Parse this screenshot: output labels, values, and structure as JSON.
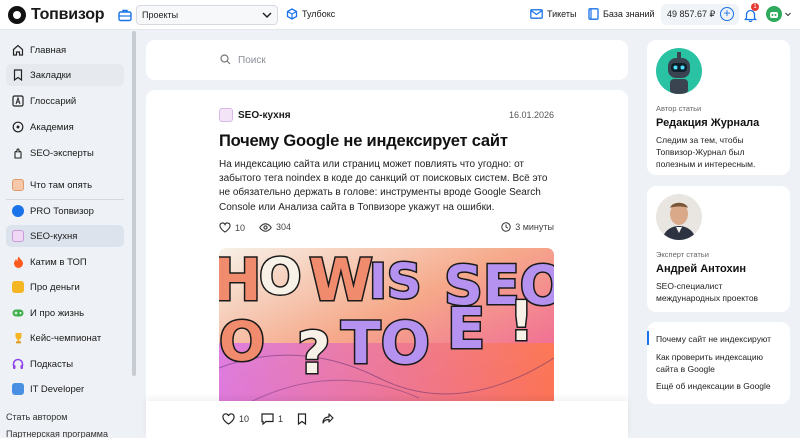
{
  "header": {
    "logo_text": "Топвизор",
    "projects_label": "Проекты",
    "toolbox_label": "Тулбокс",
    "tickets_label": "Тикеты",
    "knowledge_label": "База знаний",
    "balance": "49 857.67 ₽",
    "notifications_count": "1"
  },
  "sidebar": {
    "items": [
      {
        "label": "Главная",
        "icon": "home-icon"
      },
      {
        "label": "Закладки",
        "icon": "bookmark-icon"
      },
      {
        "label": "Глоссарий",
        "icon": "glossary-icon"
      },
      {
        "label": "Академия",
        "icon": "academy-icon"
      },
      {
        "label": "SEO-эксперты",
        "icon": "experts-icon"
      },
      {
        "label": "Что там опять",
        "icon": "news-icon"
      },
      {
        "label": "PRO Топвизор",
        "icon": "pro-topvisor-icon"
      },
      {
        "label": "SEO-кухня",
        "icon": "seo-kitchen-icon"
      },
      {
        "label": "Катим в ТОП",
        "icon": "fire-icon"
      },
      {
        "label": "Про деньги",
        "icon": "money-icon"
      },
      {
        "label": "И про жизнь",
        "icon": "gamepad-icon"
      },
      {
        "label": "Кейс-чемпионат",
        "icon": "trophy-icon"
      },
      {
        "label": "Подкасты",
        "icon": "headphones-icon"
      },
      {
        "label": "IT Developer",
        "icon": "developer-icon"
      }
    ],
    "become_author": "Стать автором",
    "partner_program": "Партнерская программа"
  },
  "search": {
    "placeholder": "Поиск"
  },
  "article": {
    "category": "SEO-кухня",
    "date": "16.01.2026",
    "title": "Почему Google не индексирует сайт",
    "lead": "На индексацию сайта или страниц может повлиять что угодно: от забытого тега noindex в коде до санкций от поисковых систем. Всё это не обязательно держать в голове: инструменты вроде Google Search Console или Анализа сайта в Топвизоре укажут на ошибки.",
    "likes": "10",
    "views": "304",
    "read_time": "3 минуты"
  },
  "action_bar": {
    "likes": "10",
    "comments": "1"
  },
  "author_card": {
    "role": "Автор статьи",
    "name": "Редакция Журнала",
    "bio": "Следим за тем, чтобы Топвизор-Журнал был полезным и интересным."
  },
  "expert_card": {
    "role": "Эксперт статьи",
    "name": "Андрей Антохин",
    "bio": "SEO-специалист международных проектов"
  },
  "toc": {
    "items": [
      "Почему сайт не индексируют",
      "Как проверить индексацию сайта в Google",
      "Ещё об индексации в Google"
    ]
  },
  "colors": {
    "accent": "#1a73e8",
    "badge": "#e53935",
    "brand_green": "#2eaa5c"
  }
}
